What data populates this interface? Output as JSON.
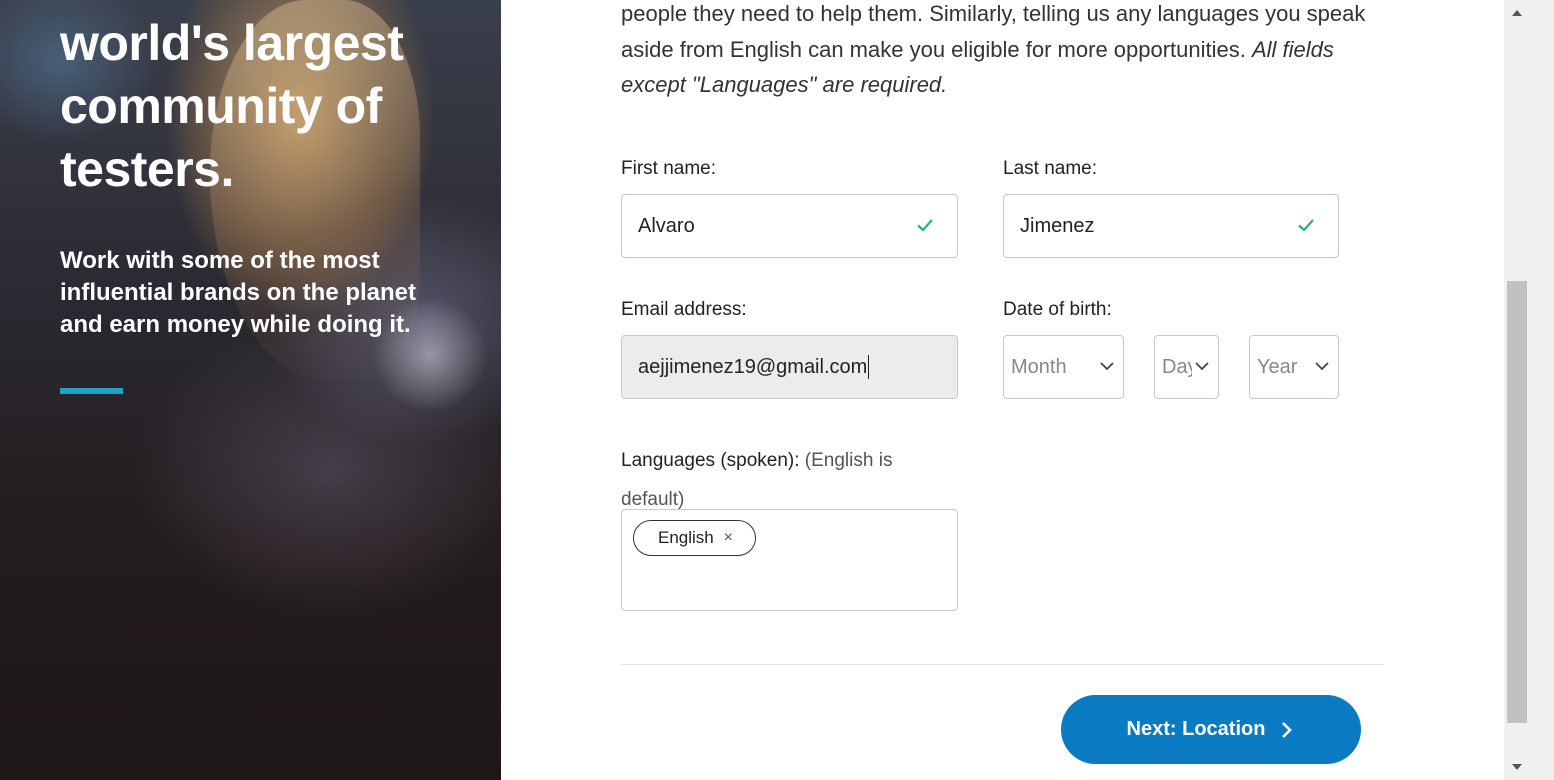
{
  "hero": {
    "headline": "world's largest community of testers.",
    "subheadline": "Work with some of the most influential brands on the planet and earn money while doing it."
  },
  "intro": {
    "text": "people they need to help them. Similarly, telling us any languages you speak aside from English can make you eligible for more opportunities.",
    "note": "All fields except \"Languages\" are required."
  },
  "form": {
    "first_name": {
      "label": "First name:",
      "value": "Alvaro"
    },
    "last_name": {
      "label": "Last name:",
      "value": "Jimenez"
    },
    "email": {
      "label": "Email address:",
      "value": "aejjimenez19@gmail.com"
    },
    "dob": {
      "label": "Date of birth:",
      "month_placeholder": "Month",
      "day_placeholder": "Day",
      "year_placeholder": "Year"
    },
    "languages": {
      "label": "Languages (spoken):",
      "hint": "(English is default)",
      "tags": [
        "English"
      ],
      "remove_symbol": "×"
    },
    "next_button": "Next: Location"
  },
  "colors": {
    "accent": "#0a7bc2",
    "hero_rule": "#1fa2c8",
    "check": "#27b36b"
  }
}
